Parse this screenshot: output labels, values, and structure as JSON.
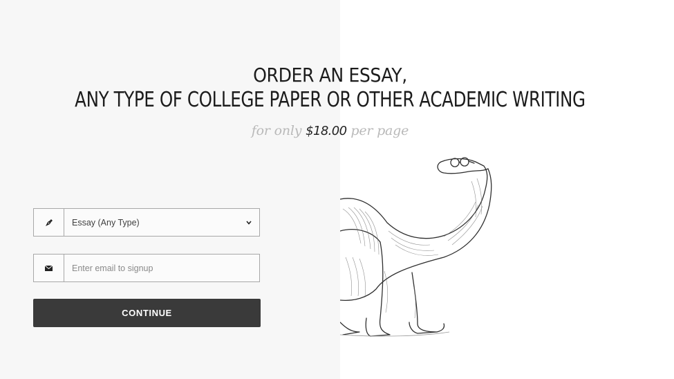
{
  "hero": {
    "title_line1": "ORDER AN ESSAY,",
    "title_line2": "ANY TYPE OF COLLEGE PAPER OR OTHER ACADEMIC WRITING",
    "price_prefix": "for only",
    "price": "$18.00",
    "price_suffix": "per page"
  },
  "form": {
    "paper_type": {
      "icon": "pen-nib-icon",
      "selected_value": "Essay (Any Type)",
      "dropdown_icon": "chevron-down-icon"
    },
    "email": {
      "icon": "envelope-icon",
      "value": "",
      "placeholder": "Enter email to signup"
    },
    "continue_label": "CONTINUE"
  },
  "illustration": {
    "subject": "sketched dinosaur wearing glasses"
  },
  "colors": {
    "left_panel_bg": "#f7f7f7",
    "right_panel_bg": "#ffffff",
    "button_bg": "#3a3a3a",
    "muted_script": "#b9b9b9",
    "field_border": "#a7a7a7"
  }
}
